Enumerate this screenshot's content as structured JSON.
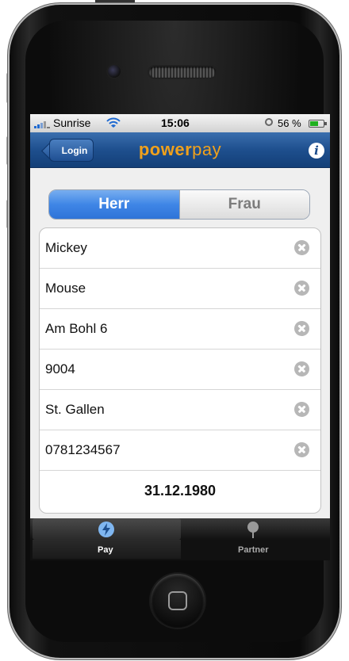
{
  "status": {
    "carrier": "Sunrise",
    "time": "15:06",
    "battery": "56 %"
  },
  "nav": {
    "back_label": "Login",
    "logo_strong": "pow",
    "logo_mid": "er",
    "logo_light": "pay",
    "info_label": "i"
  },
  "segment": {
    "options": [
      "Herr",
      "Frau"
    ],
    "selected": "Herr"
  },
  "fields": [
    "Mickey",
    "Mouse",
    "Am Bohl 6",
    "9004",
    "St. Gallen",
    "0781234567"
  ],
  "birthdate": "31.12.1980",
  "tabs": [
    {
      "label": "Pay",
      "icon": "bolt-icon"
    },
    {
      "label": "Partner",
      "icon": "pin-icon"
    }
  ],
  "colors": {
    "nav_blue": "#1e4f8e",
    "segment_blue": "#3f86e6",
    "logo_orange": "#f0a11c"
  }
}
